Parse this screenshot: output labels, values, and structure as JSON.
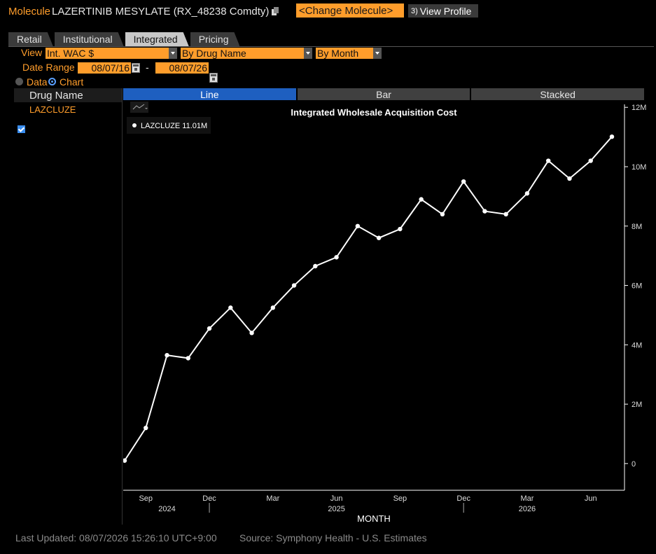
{
  "header": {
    "prefix": "Molecule",
    "title": "LAZERTINIB MESYLATE (RX_48238 Comdty)",
    "change_btn": "<Change Molecule>",
    "profile_num": "3)",
    "profile_label": "View Profile"
  },
  "tabs": [
    "Retail",
    "Institutional",
    "Integrated",
    "Pricing"
  ],
  "active_tab": "Integrated",
  "controls": {
    "view_label": "View",
    "view_value": "Int. WAC $",
    "group_value": "By Drug Name",
    "period_value": "By Month",
    "date_range_label": "Date Range",
    "date_from": "08/07/16",
    "date_sep": "-",
    "date_to": "08/07/26",
    "radio_data": "Data",
    "radio_chart": "Chart"
  },
  "sidebar": {
    "header": "Drug Name",
    "items": [
      "LAZCLUZE"
    ]
  },
  "chart_tabs": [
    "Line",
    "Bar",
    "Stacked"
  ],
  "legend_value": "LAZCLUZE 11.01M",
  "colors": {
    "accent": "#ff9d2b",
    "active_tab": "#1e5fc0",
    "line": "#ffffff"
  },
  "chart_data": {
    "type": "line",
    "title": "Integrated Wholesale Acquisition Cost",
    "xlabel": "MONTH",
    "ylabel": "",
    "ylim": [
      -0.9,
      12.1
    ],
    "y_ticks": [
      0,
      2,
      4,
      6,
      8,
      10,
      12
    ],
    "y_tick_labels": [
      "0",
      "2M",
      "4M",
      "6M",
      "8M",
      "10M",
      "12M"
    ],
    "x_months": [
      "2024-08",
      "2024-09",
      "2024-10",
      "2024-11",
      "2024-12",
      "2025-01",
      "2025-02",
      "2025-03",
      "2025-04",
      "2025-05",
      "2025-06",
      "2025-07",
      "2025-08",
      "2025-09",
      "2025-10",
      "2025-11",
      "2025-12",
      "2026-01",
      "2026-02",
      "2026-03",
      "2026-04",
      "2026-05",
      "2026-06",
      "2026-07"
    ],
    "x_tick_labels": [
      "Sep",
      "Dec",
      "Mar",
      "Jun",
      "Sep",
      "Dec",
      "Mar",
      "Jun"
    ],
    "x_tick_months": [
      "2024-09",
      "2024-12",
      "2025-03",
      "2025-06",
      "2025-09",
      "2025-12",
      "2026-03",
      "2026-06"
    ],
    "year_labels": [
      "2024",
      "2025",
      "2026"
    ],
    "year_label_months": [
      "2024-10",
      "2025-06",
      "2026-03"
    ],
    "year_divider_months": [
      "2024-12",
      "2025-12"
    ],
    "series": [
      {
        "name": "LAZCLUZE",
        "values": [
          0.1,
          1.2,
          3.65,
          3.55,
          4.55,
          5.25,
          4.4,
          5.25,
          6.0,
          6.65,
          6.95,
          8.0,
          7.6,
          7.9,
          8.9,
          8.4,
          9.5,
          8.5,
          8.4,
          9.1,
          10.2,
          9.6,
          10.2,
          11.01
        ]
      }
    ]
  },
  "footer": {
    "updated": "Last Updated: 08/07/2026 15:26:10 UTC+9:00",
    "source": "Source: Symphony Health - U.S. Estimates"
  }
}
